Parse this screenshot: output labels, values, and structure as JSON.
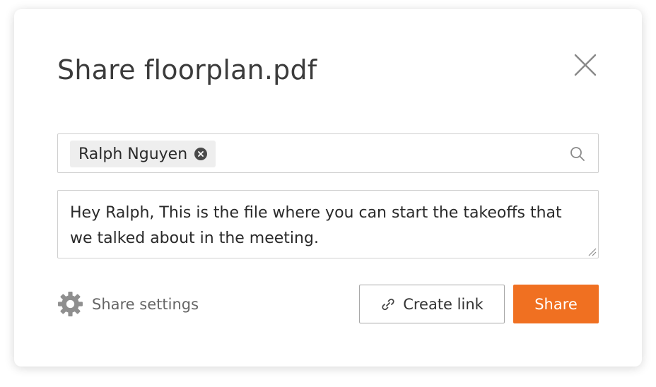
{
  "dialog": {
    "title": "Share floorplan.pdf"
  },
  "recipients": {
    "chips": [
      {
        "label": "Ralph Nguyen"
      }
    ],
    "icon": "search-icon"
  },
  "message": {
    "value": "Hey Ralph, This is the file where you can start the takeoffs that we talked about in the meeting."
  },
  "footer": {
    "settings_label": "Share settings",
    "settings_icon": "gear-icon",
    "create_link_label": "Create link",
    "create_link_icon": "link-icon",
    "share_label": "Share"
  },
  "colors": {
    "accent": "#f07021",
    "text": "#3b3b3b",
    "muted": "#666666",
    "border": "#cfcfcf"
  }
}
